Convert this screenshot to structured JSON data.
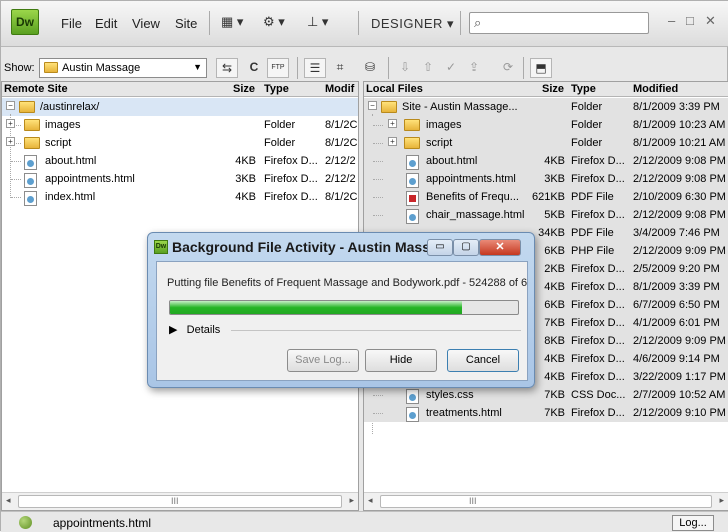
{
  "app": {
    "logo": "Dw",
    "menus": [
      "File",
      "Edit",
      "View",
      "Site"
    ],
    "workspace": "DESIGNER",
    "search_placeholder": ""
  },
  "toolbar": {
    "show_label": "Show:",
    "site": "Austin Massage"
  },
  "remote": {
    "headers": [
      "Remote Site",
      "Size",
      "Type",
      "Modif"
    ],
    "root": "/austinrelax/",
    "items": [
      {
        "name": "images",
        "size": "",
        "type": "Folder",
        "modified": "8/1/2C",
        "kind": "folder"
      },
      {
        "name": "script",
        "size": "",
        "type": "Folder",
        "modified": "8/1/2C",
        "kind": "folder"
      },
      {
        "name": "about.html",
        "size": "4KB",
        "type": "Firefox D...",
        "modified": "2/12/2",
        "kind": "file"
      },
      {
        "name": "appointments.html",
        "size": "3KB",
        "type": "Firefox D...",
        "modified": "2/12/2",
        "kind": "file"
      },
      {
        "name": "index.html",
        "size": "4KB",
        "type": "Firefox D...",
        "modified": "8/1/2C",
        "kind": "file"
      }
    ]
  },
  "local": {
    "headers": [
      "Local Files",
      "Size",
      "Type",
      "Modified"
    ],
    "root": "Site - Austin Massage...",
    "root_type": "Folder",
    "root_modified": "8/1/2009 3:39 PM",
    "items": [
      {
        "name": "images",
        "size": "",
        "type": "Folder",
        "modified": "8/1/2009 10:23 AM",
        "kind": "folder"
      },
      {
        "name": "script",
        "size": "",
        "type": "Folder",
        "modified": "8/1/2009 10:21 AM",
        "kind": "folder"
      },
      {
        "name": "about.html",
        "size": "4KB",
        "type": "Firefox D...",
        "modified": "2/12/2009 9:08 PM",
        "kind": "file"
      },
      {
        "name": "appointments.html",
        "size": "3KB",
        "type": "Firefox D...",
        "modified": "2/12/2009 9:08 PM",
        "kind": "file"
      },
      {
        "name": "Benefits of Frequ...",
        "size": "621KB",
        "type": "PDF File",
        "modified": "2/10/2009 6:30 PM",
        "kind": "pdf"
      },
      {
        "name": "chair_massage.html",
        "size": "5KB",
        "type": "Firefox D...",
        "modified": "2/12/2009 9:08 PM",
        "kind": "file"
      },
      {
        "name": "",
        "size": "34KB",
        "type": "PDF File",
        "modified": "3/4/2009 7:46 PM",
        "kind": "hidden"
      },
      {
        "name": "",
        "size": "6KB",
        "type": "PHP File",
        "modified": "2/12/2009 9:09 PM",
        "kind": "hidden"
      },
      {
        "name": "",
        "size": "2KB",
        "type": "Firefox D...",
        "modified": "2/5/2009 9:20 PM",
        "kind": "hidden"
      },
      {
        "name": "",
        "size": "4KB",
        "type": "Firefox D...",
        "modified": "8/1/2009 3:39 PM",
        "kind": "hidden"
      },
      {
        "name": "",
        "size": "6KB",
        "type": "Firefox D...",
        "modified": "6/7/2009 6:50 PM",
        "kind": "hidden"
      },
      {
        "name": "",
        "size": "7KB",
        "type": "Firefox D...",
        "modified": "4/1/2009 6:01 PM",
        "kind": "hidden"
      },
      {
        "name": "",
        "size": "8KB",
        "type": "Firefox D...",
        "modified": "2/12/2009 9:09 PM",
        "kind": "hidden"
      },
      {
        "name": "",
        "size": "4KB",
        "type": "Firefox D...",
        "modified": "4/6/2009 9:14 PM",
        "kind": "hidden"
      },
      {
        "name": "",
        "size": "4KB",
        "type": "Firefox D...",
        "modified": "3/22/2009 1:17 PM",
        "kind": "hidden"
      },
      {
        "name": "styles.css",
        "size": "7KB",
        "type": "CSS Doc...",
        "modified": "2/7/2009 10:52 AM",
        "kind": "file"
      },
      {
        "name": "treatments.html",
        "size": "7KB",
        "type": "Firefox D...",
        "modified": "2/12/2009 9:10 PM",
        "kind": "file"
      }
    ]
  },
  "dialog": {
    "title": "Background File Activity - Austin Massage",
    "message": "Putting file Benefits of Frequent Massage and Bodywork.pdf - 524288 of 6",
    "progress": 0.84,
    "details_label": "Details",
    "save_log": "Save Log...",
    "hide": "Hide",
    "cancel": "Cancel"
  },
  "status": {
    "text": "appointments.html",
    "log": "Log..."
  }
}
